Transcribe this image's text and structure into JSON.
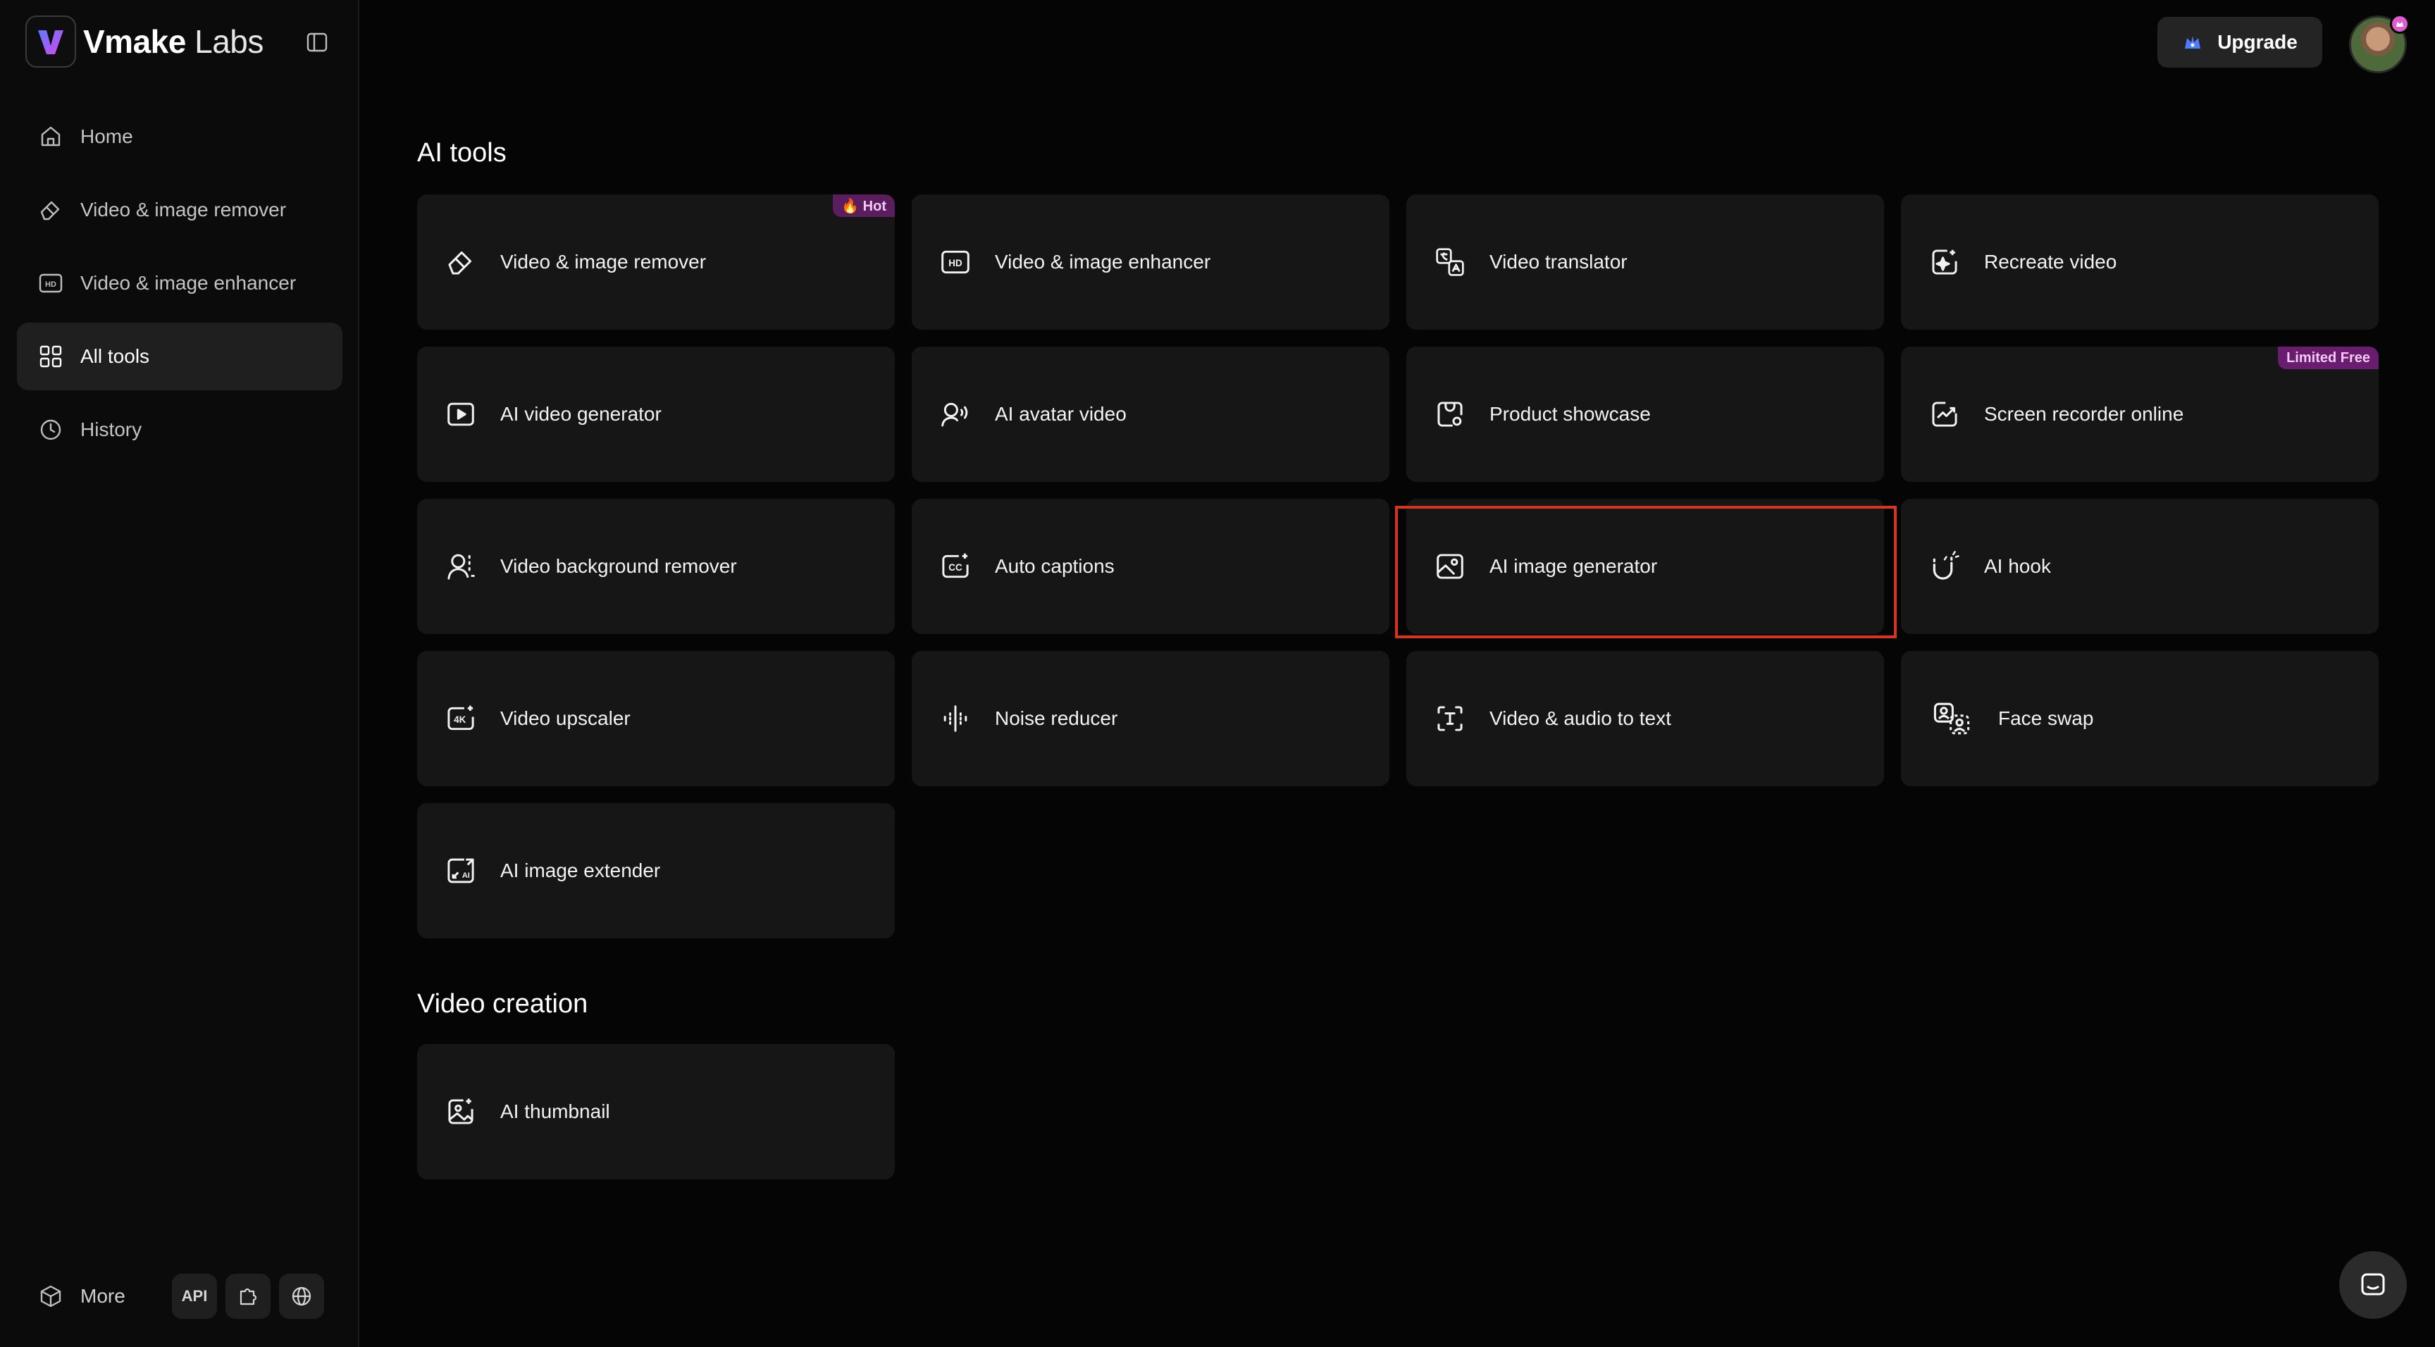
{
  "brand": {
    "name_bold": "Vmake",
    "name_light": "Labs",
    "accent": "#8b5cf6"
  },
  "sidebar": {
    "items": [
      {
        "label": "Home",
        "icon": "home-icon",
        "active": false
      },
      {
        "label": "Video & image remover",
        "icon": "eraser-icon",
        "active": false
      },
      {
        "label": "Video & image enhancer",
        "icon": "hd-icon",
        "active": false
      },
      {
        "label": "All tools",
        "icon": "grid-icon",
        "active": true
      },
      {
        "label": "History",
        "icon": "clock-icon",
        "active": false
      }
    ],
    "more_label": "More",
    "api_label": "API"
  },
  "header": {
    "upgrade_label": "Upgrade"
  },
  "sections": {
    "ai_tools": {
      "title": "AI tools",
      "cards": [
        {
          "label": "Video & image remover",
          "icon": "eraser-icon",
          "badge": "🔥 Hot"
        },
        {
          "label": "Video & image enhancer",
          "icon": "hd-icon"
        },
        {
          "label": "Video translator",
          "icon": "translate-icon"
        },
        {
          "label": "Recreate video",
          "icon": "recreate-icon"
        },
        {
          "label": "AI video generator",
          "icon": "play-icon"
        },
        {
          "label": "AI avatar video",
          "icon": "avatar-voice-icon"
        },
        {
          "label": "Product showcase",
          "icon": "product-icon"
        },
        {
          "label": "Screen recorder online",
          "icon": "screen-chart-icon",
          "badge": "Limited Free"
        },
        {
          "label": "Video background remover",
          "icon": "person-dashed-icon"
        },
        {
          "label": "Auto captions",
          "icon": "cc-icon"
        },
        {
          "label": "AI image generator",
          "icon": "image-icon",
          "highlighted": true
        },
        {
          "label": "AI hook",
          "icon": "magnet-icon"
        },
        {
          "label": "Video upscaler",
          "icon": "4k-icon"
        },
        {
          "label": "Noise reducer",
          "icon": "waveform-icon"
        },
        {
          "label": "Video & audio to text",
          "icon": "text-scan-icon"
        },
        {
          "label": "Face swap",
          "icon": "face-swap-icon"
        },
        {
          "label": "AI image extender",
          "icon": "expand-ai-icon"
        }
      ]
    },
    "video_creation": {
      "title": "Video creation",
      "cards": [
        {
          "label": "AI thumbnail",
          "icon": "thumbnail-icon"
        }
      ]
    }
  }
}
